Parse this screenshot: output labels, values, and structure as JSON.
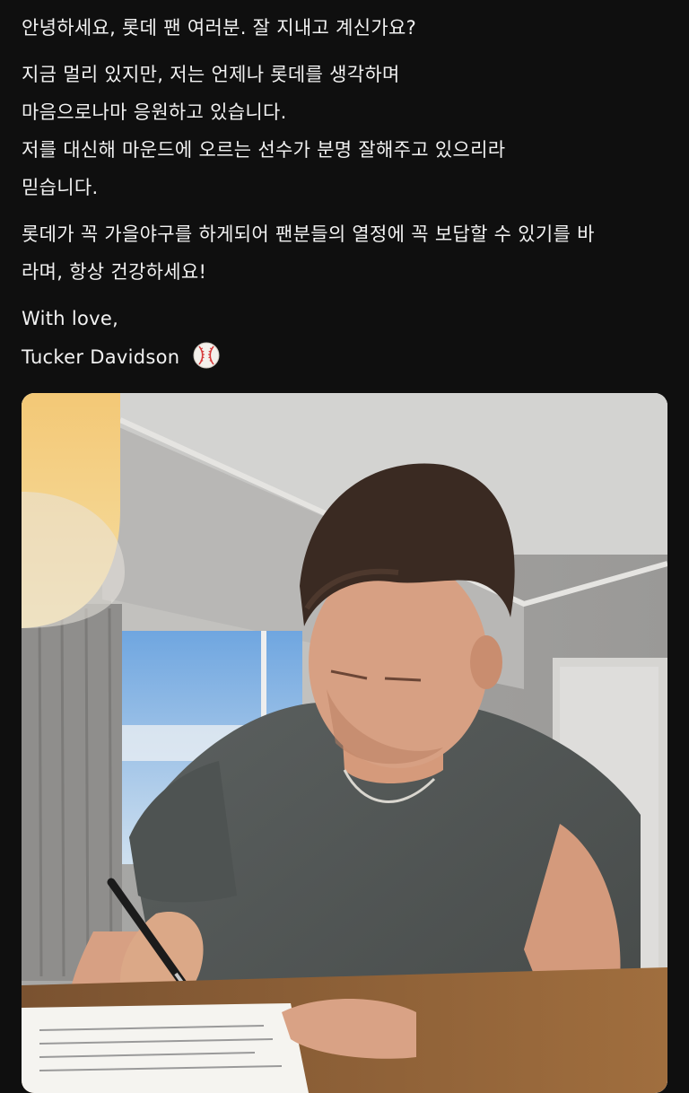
{
  "post": {
    "greeting": "안녕하세요, 롯데 팬 여러분. 잘 지내고 계신가요?",
    "paragraph1": [
      "지금 멀리 있지만, 저는 언제나 롯데를 생각하며",
      "마음으로나마 응원하고 있습니다.",
      "저를 대신해 마운드에 오르는 선수가 분명 잘해주고 있으리라",
      "믿습니다."
    ],
    "paragraph2": [
      "롯데가 꼭 가을야구를 하게되어 팬분들의 열정에 꼭 보답할 수 있기를 바",
      "라며, 항상 건강하세요!"
    ],
    "closing": "With love,",
    "signature": "Tucker Davidson",
    "signature_icon": "baseball-icon"
  },
  "photo": {
    "subject": "man-signing-document-photo"
  },
  "colors": {
    "background": "#0f0f0f",
    "text": "#f2f2f2"
  }
}
